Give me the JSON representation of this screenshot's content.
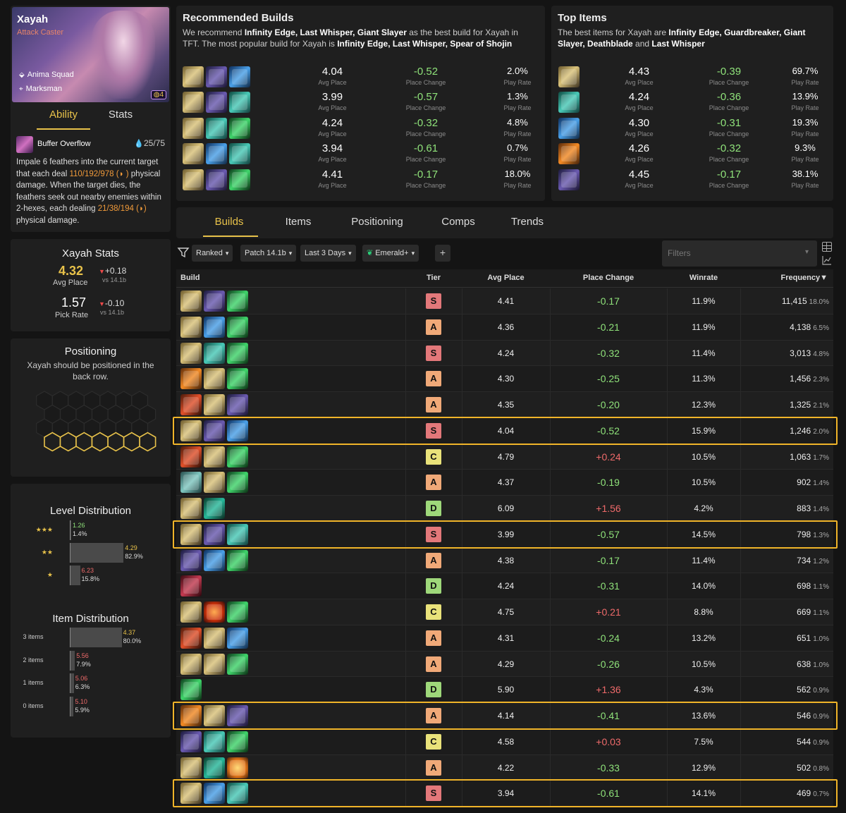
{
  "champion": {
    "name": "Xayah",
    "role": "Attack Caster",
    "traits": [
      "Anima Squad",
      "Marksman"
    ],
    "cost": "4",
    "tabs": [
      "Ability",
      "Stats"
    ],
    "ability_name": "Buffer Overflow",
    "mana_start": "25",
    "mana_max": "/75",
    "ability_desc_1": "Impale 6 feathers into the current target that each deal ",
    "ability_dmg_1": "110/192/978",
    "ability_desc_2": " physical damage. When the target dies, the feathers seek out nearby enemies within 2-hexes, each dealing ",
    "ability_dmg_2": "21/38/194",
    "ability_desc_3": " physical damage."
  },
  "stats": {
    "title": "Xayah Stats",
    "avg_place": "4.32",
    "avg_place_label": "Avg Place",
    "avg_delta": "+0.18",
    "avg_vs": "vs 14.1b",
    "pick_rate": "1.57",
    "pick_rate_label": "Pick Rate",
    "pick_delta": "-0.10",
    "pick_vs": "vs 14.1b"
  },
  "positioning": {
    "title": "Positioning",
    "desc": "Xayah should be positioned in the back row."
  },
  "level_dist": {
    "title": "Level Distribution",
    "rows": [
      {
        "stars": "★★★",
        "avg": "1.26",
        "pct": "1.4%",
        "frac": 0.014,
        "avg_color": "#8fe27a"
      },
      {
        "stars": "★★",
        "avg": "4.29",
        "pct": "82.9%",
        "frac": 0.829,
        "avg_color": "#e8c24a"
      },
      {
        "stars": "★",
        "avg": "6.23",
        "pct": "15.8%",
        "frac": 0.158,
        "avg_color": "#ee6a6a"
      }
    ]
  },
  "item_dist": {
    "title": "Item Distribution",
    "rows": [
      {
        "label": "3 items",
        "avg": "4.37",
        "pct": "80.0%",
        "frac": 0.8,
        "avg_color": "#e8c24a"
      },
      {
        "label": "2 items",
        "avg": "5.56",
        "pct": "7.9%",
        "frac": 0.079,
        "avg_color": "#ee6a6a"
      },
      {
        "label": "1 items",
        "avg": "5.06",
        "pct": "6.3%",
        "frac": 0.063,
        "avg_color": "#ee6a6a"
      },
      {
        "label": "0 items",
        "avg": "5.10",
        "pct": "5.9%",
        "frac": 0.059,
        "avg_color": "#ee6a6a"
      }
    ]
  },
  "recommended": {
    "title": "Recommended Builds",
    "desc_pre": "We recommend ",
    "desc_b1": "Infinity Edge, Last Whisper, Giant Slayer",
    "desc_mid": " as the best build for Xayah in TFT. The most popular build for Xayah is ",
    "desc_b2": "Infinity Edge, Last Whisper, Spear of Shojin",
    "rows": [
      {
        "icons": [
          "ic-ie",
          "ic-lw",
          "ic-gs"
        ],
        "avg": "4.04",
        "change": "-0.52",
        "rate": "2.0%"
      },
      {
        "icons": [
          "ic-ie",
          "ic-lw",
          "ic-sos"
        ],
        "avg": "3.99",
        "change": "-0.57",
        "rate": "1.3%"
      },
      {
        "icons": [
          "ic-ie",
          "ic-sos",
          "ic-gb"
        ],
        "avg": "4.24",
        "change": "-0.32",
        "rate": "4.8%"
      },
      {
        "icons": [
          "ic-ie",
          "ic-gs",
          "ic-sos"
        ],
        "avg": "3.94",
        "change": "-0.61",
        "rate": "0.7%"
      },
      {
        "icons": [
          "ic-ie",
          "ic-lw",
          "ic-gb"
        ],
        "avg": "4.41",
        "change": "-0.17",
        "rate": "18.0%"
      }
    ],
    "avg_label": "Avg Place",
    "change_label": "Place Change",
    "rate_label": "Play Rate"
  },
  "top_items": {
    "title": "Top Items",
    "desc_pre": "The best items for Xayah are ",
    "desc_b1": "Infinity Edge, Guardbreaker, Giant Slayer, Deathblade",
    "desc_mid": " and ",
    "desc_b2": "Last Whisper",
    "rows": [
      {
        "icon": "ic-ie",
        "avg": "4.43",
        "change": "-0.39",
        "rate": "69.7%"
      },
      {
        "icon": "ic-sos",
        "avg": "4.24",
        "change": "-0.36",
        "rate": "13.9%"
      },
      {
        "icon": "ic-gs",
        "avg": "4.30",
        "change": "-0.31",
        "rate": "19.3%"
      },
      {
        "icon": "ic-db",
        "avg": "4.26",
        "change": "-0.32",
        "rate": "9.3%"
      },
      {
        "icon": "ic-lw",
        "avg": "4.45",
        "change": "-0.17",
        "rate": "38.1%"
      }
    ]
  },
  "tabs": [
    "Builds",
    "Items",
    "Positioning",
    "Comps",
    "Trends"
  ],
  "filters": {
    "ranked": "Ranked",
    "patch": "Patch 14.1b",
    "days": "Last 3 Days",
    "rank": "Emerald+",
    "plus": "+",
    "placeholder": "Filters"
  },
  "table": {
    "headers": [
      "Build",
      "Tier",
      "Avg Place",
      "Place Change",
      "Winrate",
      "Frequency▼"
    ],
    "rows": [
      {
        "icons": [
          "ic-ie",
          "ic-lw",
          "ic-gb"
        ],
        "tier": "S",
        "avg": "4.41",
        "change": "-0.17",
        "win": "11.9%",
        "freq": "11,415",
        "freqpct": "18.0%",
        "hl": false
      },
      {
        "icons": [
          "ic-ie",
          "ic-gs",
          "ic-gb"
        ],
        "tier": "A",
        "avg": "4.36",
        "change": "-0.21",
        "win": "11.9%",
        "freq": "4,138",
        "freqpct": "6.5%",
        "hl": false
      },
      {
        "icons": [
          "ic-ie",
          "ic-sos",
          "ic-gb"
        ],
        "tier": "S",
        "avg": "4.24",
        "change": "-0.32",
        "win": "11.4%",
        "freq": "3,013",
        "freqpct": "4.8%",
        "hl": false
      },
      {
        "icons": [
          "ic-db",
          "ic-ie",
          "ic-gb"
        ],
        "tier": "A",
        "avg": "4.30",
        "change": "-0.25",
        "win": "11.3%",
        "freq": "1,456",
        "freqpct": "2.3%",
        "hl": false
      },
      {
        "icons": [
          "ic-rh",
          "ic-ie",
          "ic-lw"
        ],
        "tier": "A",
        "avg": "4.35",
        "change": "-0.20",
        "win": "12.3%",
        "freq": "1,325",
        "freqpct": "2.1%",
        "hl": false
      },
      {
        "icons": [
          "ic-ie",
          "ic-lw",
          "ic-gs"
        ],
        "tier": "S",
        "avg": "4.04",
        "change": "-0.52",
        "win": "15.9%",
        "freq": "1,246",
        "freqpct": "2.0%",
        "hl": true
      },
      {
        "icons": [
          "ic-rh",
          "ic-ie",
          "ic-gb"
        ],
        "tier": "C",
        "avg": "4.79",
        "change": "+0.24",
        "win": "10.5%",
        "freq": "1,063",
        "freqpct": "1.7%",
        "hl": false
      },
      {
        "icons": [
          "ic-bv",
          "ic-ie",
          "ic-gb"
        ],
        "tier": "A",
        "avg": "4.37",
        "change": "-0.19",
        "win": "10.5%",
        "freq": "902",
        "freqpct": "1.4%",
        "hl": false
      },
      {
        "icons": [
          "ic-ie",
          "ic-gd"
        ],
        "tier": "D",
        "avg": "6.09",
        "change": "+1.56",
        "win": "4.2%",
        "freq": "883",
        "freqpct": "1.4%",
        "hl": false
      },
      {
        "icons": [
          "ic-ie",
          "ic-lw",
          "ic-sos"
        ],
        "tier": "S",
        "avg": "3.99",
        "change": "-0.57",
        "win": "14.5%",
        "freq": "798",
        "freqpct": "1.3%",
        "hl": true
      },
      {
        "icons": [
          "ic-lw",
          "ic-gs",
          "ic-gb"
        ],
        "tier": "A",
        "avg": "4.38",
        "change": "-0.17",
        "win": "11.4%",
        "freq": "734",
        "freqpct": "1.2%",
        "hl": false
      },
      {
        "icons": [
          "ic-cr"
        ],
        "tier": "D",
        "avg": "4.24",
        "change": "-0.31",
        "win": "14.0%",
        "freq": "698",
        "freqpct": "1.1%",
        "hl": false
      },
      {
        "icons": [
          "ic-ie",
          "ic-fire",
          "ic-gb"
        ],
        "tier": "C",
        "avg": "4.75",
        "change": "+0.21",
        "win": "8.8%",
        "freq": "669",
        "freqpct": "1.1%",
        "hl": false
      },
      {
        "icons": [
          "ic-rh",
          "ic-ie",
          "ic-gs"
        ],
        "tier": "A",
        "avg": "4.31",
        "change": "-0.24",
        "win": "13.2%",
        "freq": "651",
        "freqpct": "1.0%",
        "hl": false
      },
      {
        "icons": [
          "ic-ie",
          "ic-ie",
          "ic-gb"
        ],
        "tier": "A",
        "avg": "4.29",
        "change": "-0.26",
        "win": "10.5%",
        "freq": "638",
        "freqpct": "1.0%",
        "hl": false
      },
      {
        "icons": [
          "ic-gb"
        ],
        "tier": "D",
        "avg": "5.90",
        "change": "+1.36",
        "win": "4.3%",
        "freq": "562",
        "freqpct": "0.9%",
        "hl": false
      },
      {
        "icons": [
          "ic-db",
          "ic-ie",
          "ic-lw"
        ],
        "tier": "A",
        "avg": "4.14",
        "change": "-0.41",
        "win": "13.6%",
        "freq": "546",
        "freqpct": "0.9%",
        "hl": true
      },
      {
        "icons": [
          "ic-lw",
          "ic-sos",
          "ic-gb"
        ],
        "tier": "C",
        "avg": "4.58",
        "change": "+0.03",
        "win": "7.5%",
        "freq": "544",
        "freqpct": "0.9%",
        "hl": false
      },
      {
        "icons": [
          "ic-ie",
          "ic-gd",
          "ic-sun"
        ],
        "tier": "A",
        "avg": "4.22",
        "change": "-0.33",
        "win": "12.9%",
        "freq": "502",
        "freqpct": "0.8%",
        "hl": false
      },
      {
        "icons": [
          "ic-ie",
          "ic-gs",
          "ic-sos"
        ],
        "tier": "S",
        "avg": "3.94",
        "change": "-0.61",
        "win": "14.1%",
        "freq": "469",
        "freqpct": "0.7%",
        "hl": true
      }
    ]
  },
  "colors": {
    "tier_S": "#e3787a",
    "tier_A": "#f0a978",
    "tier_C": "#e9e27a",
    "tier_D": "#9ed87a",
    "highlight": "#f0b429",
    "accent": "#e8c24a"
  }
}
